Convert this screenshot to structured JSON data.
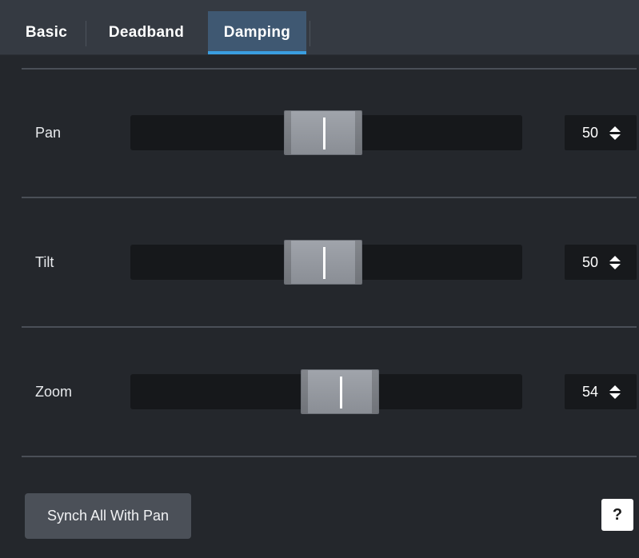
{
  "tabs": [
    {
      "label": "Basic",
      "active": false
    },
    {
      "label": "Deadband",
      "active": false
    },
    {
      "label": "Damping",
      "active": true
    }
  ],
  "rows": [
    {
      "label": "Pan",
      "value": "50",
      "level_percent": 50,
      "icon": "up-down-arrows-icon"
    },
    {
      "label": "Tilt",
      "value": "50",
      "level_percent": 50,
      "icon": "up-down-arrows-icon"
    },
    {
      "label": "Zoom",
      "value": "54",
      "level_percent": 54,
      "icon": "up-down-arrows-icon"
    }
  ],
  "buttons": {
    "synch_label": "Synch All With Pan",
    "help_label": "?"
  },
  "colors": {
    "accent": "#3a9ee0",
    "active_tab": "#3f5872",
    "background": "#24272c"
  }
}
